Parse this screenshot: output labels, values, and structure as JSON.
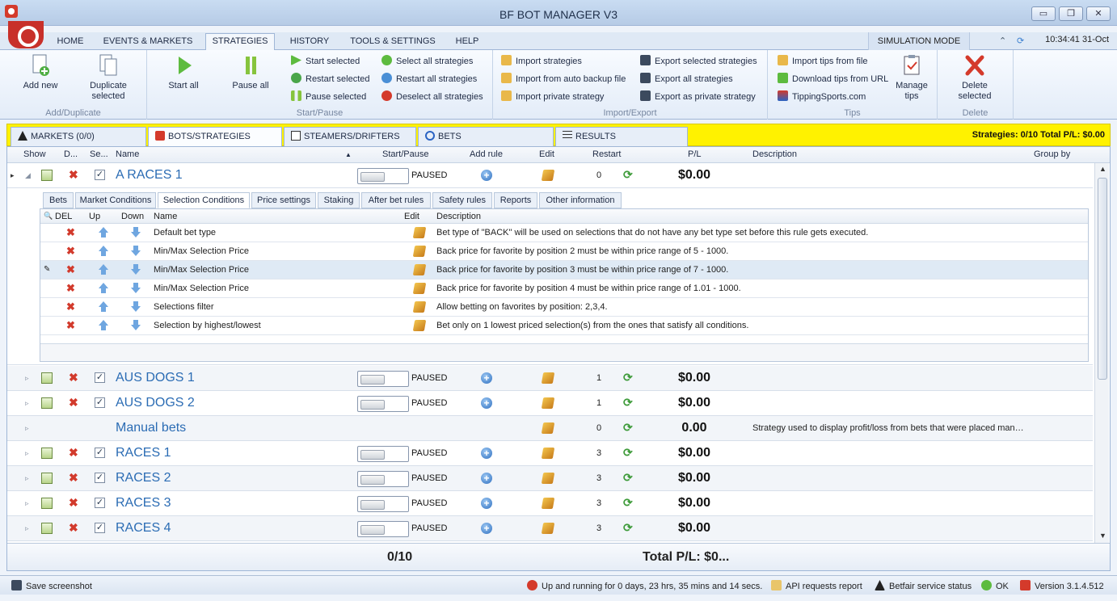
{
  "window": {
    "title": "BF BOT MANAGER V3",
    "minimize": "▭",
    "restore": "❐",
    "close": "✕"
  },
  "menu": {
    "tabs": [
      "HOME",
      "EVENTS & MARKETS",
      "STRATEGIES",
      "HISTORY",
      "TOOLS & SETTINGS",
      "HELP"
    ],
    "active": "STRATEGIES",
    "simulation": "SIMULATION MODE",
    "clock": "10:34:41 31-Oct"
  },
  "ribbon": {
    "add_new": "Add new",
    "duplicate_selected": "Duplicate selected",
    "group_add": "Add/Duplicate",
    "start_all": "Start all",
    "pause_all": "Pause all",
    "start_selected": "Start selected",
    "restart_selected": "Restart selected",
    "pause_selected": "Pause selected",
    "select_all": "Select all strategies",
    "restart_all": "Restart all strategies",
    "deselect_all": "Deselect all strategies",
    "group_start": "Start/Pause",
    "import_strategies": "Import strategies",
    "import_backup": "Import from auto backup file",
    "import_private": "Import private strategy",
    "export_selected": "Export selected strategies",
    "export_all": "Export all strategies",
    "export_private": "Export as private strategy",
    "group_import": "Import/Export",
    "import_tips_file": "Import tips from file",
    "download_tips_url": "Download tips from URL",
    "tippingsports": "TippingSports.com",
    "manage_tips": "Manage tips",
    "group_tips": "Tips",
    "delete_selected": "Delete selected",
    "group_delete": "Delete"
  },
  "doctabs": [
    "MARKETS (0/0)",
    "BOTS/STRATEGIES",
    "STEAMERS/DRIFTERS",
    "BETS",
    "RESULTS"
  ],
  "strategies_summary": "Strategies: 0/10  Total P/L: $0.00",
  "grid": {
    "headers": [
      "Show",
      "D...",
      "Se...",
      "Name",
      "Start/Pause",
      "Add rule",
      "Edit",
      "Restart",
      "P/L",
      "Description",
      "Group by"
    ],
    "expanded_row": {
      "name": "A RACES 1",
      "status": "PAUSED",
      "restart": "0",
      "pl": "$0.00",
      "description": ""
    },
    "rows": [
      {
        "name": "AUS DOGS 1",
        "status": "PAUSED",
        "restart": "1",
        "pl": "$0.00",
        "description": "",
        "manual": false
      },
      {
        "name": "AUS DOGS 2",
        "status": "PAUSED",
        "restart": "1",
        "pl": "$0.00",
        "description": "",
        "manual": false
      },
      {
        "name": "Manual bets",
        "status": "",
        "restart": "0",
        "pl": "0.00",
        "description": "Strategy used to display profit/loss from bets that were placed man…",
        "manual": true
      },
      {
        "name": "RACES 1",
        "status": "PAUSED",
        "restart": "3",
        "pl": "$0.00",
        "description": "",
        "manual": false
      },
      {
        "name": "RACES 2",
        "status": "PAUSED",
        "restart": "3",
        "pl": "$0.00",
        "description": "",
        "manual": false
      },
      {
        "name": "RACES 3",
        "status": "PAUSED",
        "restart": "3",
        "pl": "$0.00",
        "description": "",
        "manual": false
      },
      {
        "name": "RACES 4",
        "status": "PAUSED",
        "restart": "3",
        "pl": "$0.00",
        "description": "",
        "manual": false
      }
    ],
    "footer_count": "0/10",
    "footer_total": "Total P/L: $0..."
  },
  "detail": {
    "tabs": [
      "Bets",
      "Market Conditions",
      "Selection Conditions",
      "Price settings",
      "Staking",
      "After bet rules",
      "Safety rules",
      "Reports",
      "Other information"
    ],
    "active_tab": "Selection Conditions",
    "headers": [
      "DEL",
      "Up",
      "Down",
      "Name",
      "Edit",
      "Description"
    ],
    "rules": [
      {
        "name": "Default bet type",
        "description": "Bet type of \"BACK\" will be used on selections that do not have any bet type set before this rule gets executed."
      },
      {
        "name": "Min/Max Selection Price",
        "description": "Back price  for favorite by position 2 must be within price range of 5 - 1000."
      },
      {
        "name": "Min/Max Selection Price",
        "description": "Back price  for favorite by position 3 must be within price range of 7 - 1000."
      },
      {
        "name": "Min/Max Selection Price",
        "description": "Back price  for favorite by position 4 must be within price range of 1.01 - 1000."
      },
      {
        "name": "Selections filter",
        "description": "Allow betting on favorites by position: 2,3,4."
      },
      {
        "name": "Selection by highest/lowest",
        "description": "Bet only on 1 lowest priced selection(s) from the ones that satisfy all conditions."
      }
    ]
  },
  "status": {
    "save_screenshot": "Save screenshot",
    "uptime": "Up and running for 0 days, 23 hrs, 35 mins and 14 secs.",
    "api_report": "API requests report",
    "betfair_status": "Betfair service status",
    "ok": "OK",
    "version": "Version 3.1.4.512"
  }
}
